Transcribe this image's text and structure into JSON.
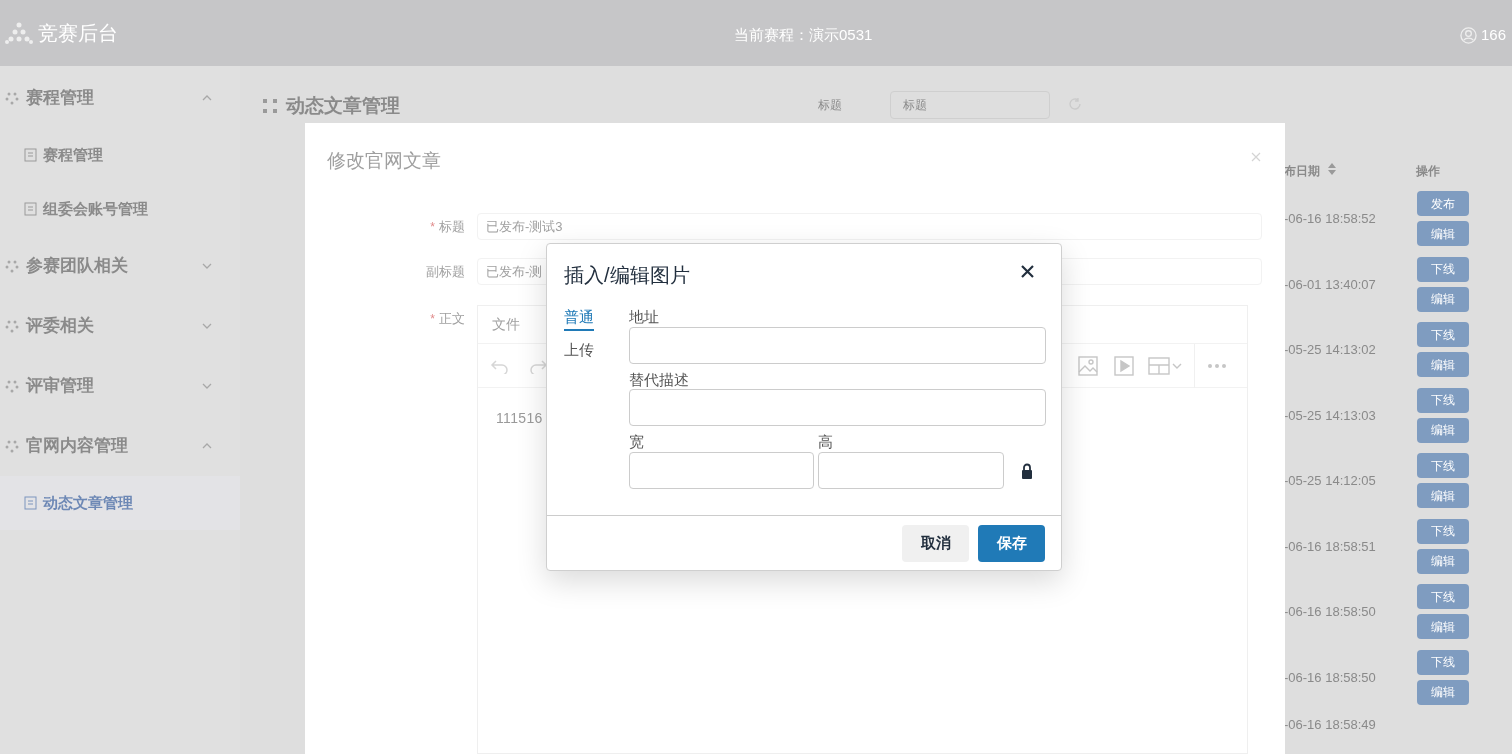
{
  "header": {
    "app_name": "竞赛后台",
    "current": "当前赛程：演示0531",
    "user": "166"
  },
  "sidebar": {
    "groups": [
      {
        "label": "赛程管理",
        "expanded": true,
        "children": [
          {
            "label": "赛程管理",
            "selected": false
          },
          {
            "label": "组委会账号管理",
            "selected": false
          }
        ]
      },
      {
        "label": "参赛团队相关",
        "expanded": false
      },
      {
        "label": "评委相关",
        "expanded": false
      },
      {
        "label": "评审管理",
        "expanded": false
      },
      {
        "label": "官网内容管理",
        "expanded": true,
        "children": [
          {
            "label": "动态文章管理",
            "selected": true
          }
        ]
      }
    ]
  },
  "page": {
    "title": "动态文章管理",
    "search_label": "标题",
    "search_placeholder": "标题"
  },
  "table": {
    "columns": [
      "布日期",
      "操作"
    ],
    "rows": [
      {
        "date": "-06-16 18:58:52",
        "actions": [
          "发布",
          "编辑"
        ]
      },
      {
        "date": "-06-01 13:40:07",
        "actions": [
          "下线",
          "编辑"
        ]
      },
      {
        "date": "-05-25 14:13:02",
        "actions": [
          "下线",
          "编辑"
        ]
      },
      {
        "date": "-05-25 14:13:03",
        "actions": [
          "下线",
          "编辑"
        ]
      },
      {
        "date": "-05-25 14:12:05",
        "actions": [
          "下线",
          "编辑"
        ]
      },
      {
        "date": "-06-16 18:58:51",
        "actions": [
          "下线",
          "编辑"
        ]
      },
      {
        "date": "-06-16 18:58:50",
        "actions": [
          "下线",
          "编辑"
        ]
      },
      {
        "date": "-06-16 18:58:50",
        "actions": [
          "下线",
          "编辑"
        ]
      },
      {
        "date": "-06-16 18:58:49",
        "actions": []
      }
    ]
  },
  "edit_modal": {
    "title": "修改官网文章",
    "fields": [
      {
        "required_mark": "*",
        "label": "标题",
        "value": "已发布-测试3"
      },
      {
        "label": "副标题",
        "value": "已发布-测"
      }
    ],
    "body_required_mark": "*",
    "body_label": "正文",
    "editor": {
      "menu": [
        "文件"
      ],
      "content": "111516"
    }
  },
  "image_dialog": {
    "title": "插入/编辑图片",
    "tabs": [
      {
        "label": "普通",
        "selected": true
      },
      {
        "label": "上传",
        "selected": false
      }
    ],
    "source_label": "地址",
    "alt_label": "替代描述",
    "width_label": "宽",
    "height_label": "高",
    "buttons": [
      {
        "label": "取消",
        "kind": "secondary"
      },
      {
        "label": "保存",
        "kind": "primary"
      }
    ]
  }
}
